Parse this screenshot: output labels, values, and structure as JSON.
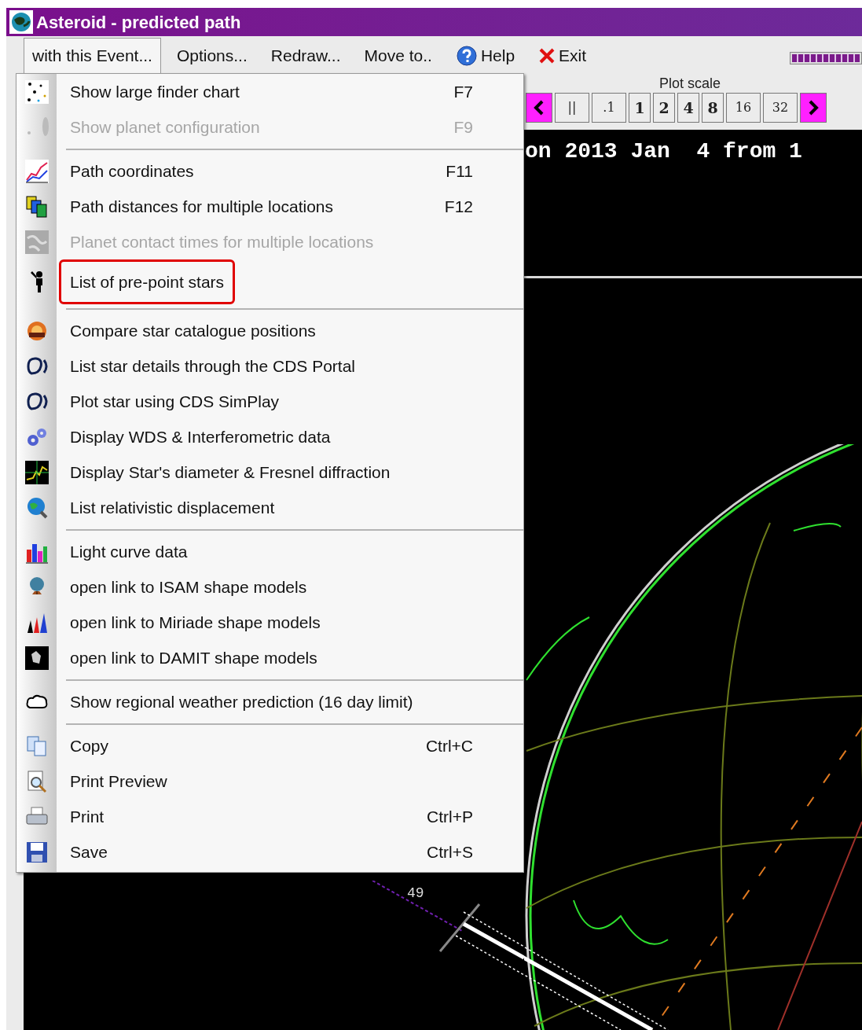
{
  "window": {
    "title": "Asteroid - predicted path"
  },
  "menu_bar": [
    {
      "label": "with this Event...",
      "kind": "plain",
      "selected": true
    },
    {
      "label": "Options...",
      "kind": "plain",
      "selected": false
    },
    {
      "label": "Redraw...",
      "kind": "plain",
      "selected": false
    },
    {
      "label": "Move to..",
      "kind": "plain",
      "selected": false
    },
    {
      "label": "Help",
      "kind": "help",
      "selected": false
    },
    {
      "label": "Exit",
      "kind": "exit",
      "selected": false
    }
  ],
  "progress": {
    "level": 1
  },
  "plot_scale": {
    "label": "Plot scale",
    "buttons": [
      {
        "kind": "prev"
      },
      {
        "kind": "text",
        "label": "||"
      },
      {
        "kind": "text",
        "label": ".1"
      },
      {
        "kind": "text",
        "label": "1"
      },
      {
        "kind": "text",
        "label": "2"
      },
      {
        "kind": "text",
        "label": "4"
      },
      {
        "kind": "text",
        "label": "8"
      },
      {
        "kind": "text",
        "label": "16"
      },
      {
        "kind": "text",
        "label": "32"
      },
      {
        "kind": "next"
      }
    ]
  },
  "plot": {
    "heading": "on 2013 Jan  4 from 1",
    "path_label": "49"
  },
  "dropdown": [
    {
      "kind": "item",
      "label": "Show large finder chart",
      "shortcut": "F7",
      "disabled": false,
      "highlighted": false
    },
    {
      "kind": "item",
      "label": "Show planet configuration",
      "shortcut": "F9",
      "disabled": true,
      "highlighted": false
    },
    {
      "kind": "separator"
    },
    {
      "kind": "item",
      "label": "Path coordinates",
      "shortcut": "F11",
      "disabled": false,
      "highlighted": false
    },
    {
      "kind": "item",
      "label": "Path distances for multiple locations",
      "shortcut": "F12",
      "disabled": false,
      "highlighted": false
    },
    {
      "kind": "item",
      "label": "Planet contact times for multiple locations",
      "disabled": true,
      "highlighted": false
    },
    {
      "kind": "item",
      "label": "List of pre-point stars",
      "disabled": false,
      "highlighted": true
    },
    {
      "kind": "separator"
    },
    {
      "kind": "item",
      "label": "Compare star catalogue positions",
      "disabled": false,
      "highlighted": false
    },
    {
      "kind": "item",
      "label": "List star details through the CDS Portal",
      "disabled": false,
      "highlighted": false
    },
    {
      "kind": "item",
      "label": "Plot star using CDS SimPlay",
      "disabled": false,
      "highlighted": false
    },
    {
      "kind": "item",
      "label": "Display WDS & Interferometric data",
      "disabled": false,
      "highlighted": false
    },
    {
      "kind": "item",
      "label": "Display Star's diameter & Fresnel diffraction",
      "disabled": false,
      "highlighted": false
    },
    {
      "kind": "item",
      "label": "List relativistic displacement",
      "disabled": false,
      "highlighted": false
    },
    {
      "kind": "separator"
    },
    {
      "kind": "item",
      "label": "Light curve data",
      "disabled": false,
      "highlighted": false
    },
    {
      "kind": "item",
      "label": "open link to ISAM shape models",
      "disabled": false,
      "highlighted": false
    },
    {
      "kind": "item",
      "label": "open link to Miriade shape models",
      "disabled": false,
      "highlighted": false
    },
    {
      "kind": "item",
      "label": "open link to DAMIT shape models",
      "disabled": false,
      "highlighted": false
    },
    {
      "kind": "separator"
    },
    {
      "kind": "item",
      "label": "Show regional weather prediction (16 day limit)",
      "disabled": false,
      "highlighted": false
    },
    {
      "kind": "separator"
    },
    {
      "kind": "item",
      "label": "Copy",
      "shortcut": "Ctrl+C",
      "disabled": false,
      "highlighted": false
    },
    {
      "kind": "item",
      "label": "Print Preview",
      "disabled": false,
      "highlighted": false
    },
    {
      "kind": "item",
      "label": "Print",
      "shortcut": "Ctrl+P",
      "disabled": false,
      "highlighted": false
    },
    {
      "kind": "item",
      "label": "Save",
      "shortcut": "Ctrl+S",
      "disabled": false,
      "highlighted": false
    }
  ]
}
